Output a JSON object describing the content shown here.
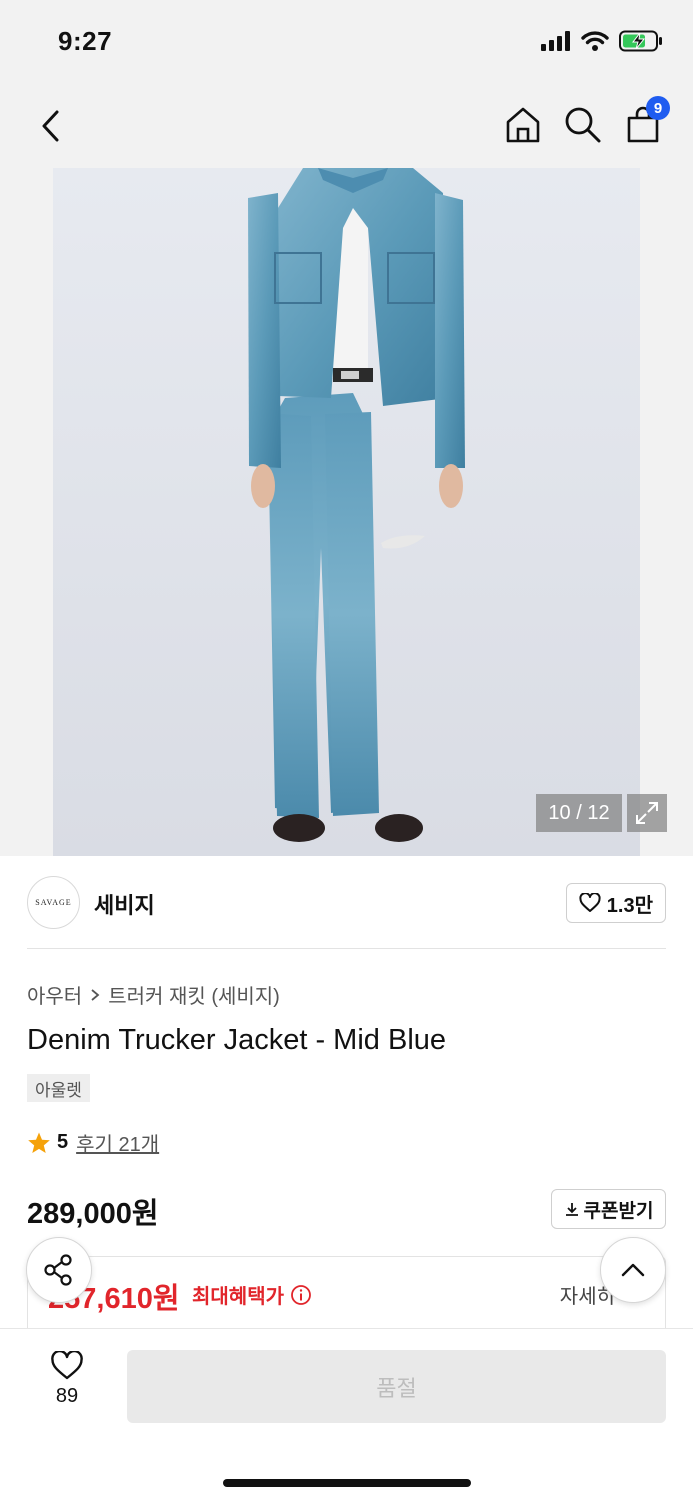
{
  "status_bar": {
    "time": "9:27"
  },
  "nav": {
    "cart_count": "9"
  },
  "gallery": {
    "counter": "10 / 12"
  },
  "brand": {
    "logo_text": "SAVAGE",
    "name": "세비지",
    "likes": "1.3만"
  },
  "breadcrumb": {
    "category": "아우터",
    "subcategory": "트러커 재킷 (세비지)"
  },
  "product": {
    "title": "Denim Trucker Jacket - Mid Blue",
    "tag": "아울렛",
    "rating": "5",
    "reviews": "후기 21개",
    "price": "289,000원",
    "coupon_label": "쿠폰받기"
  },
  "benefit": {
    "price": "257,610원",
    "label": "최대혜택가",
    "detail": "자세히"
  },
  "bottom_bar": {
    "wish_count": "89",
    "buy_label": "품절"
  },
  "colors": {
    "accent_red": "#e1252b",
    "badge_blue": "#1f5cf0",
    "star": "#f5a20a"
  }
}
